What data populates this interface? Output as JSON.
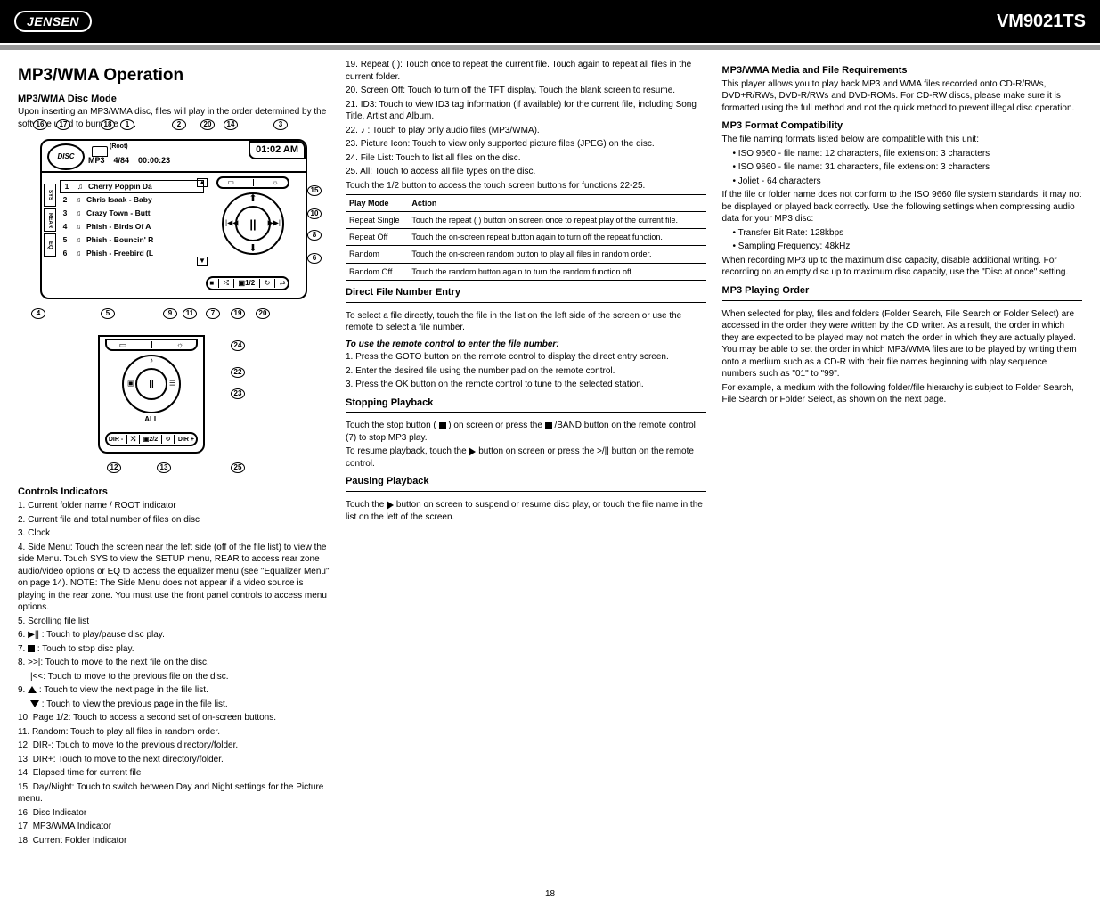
{
  "brand": "JENSEN",
  "model": "VM9021TS",
  "page_number": "18",
  "section_title": "MP3/WMA Operation",
  "section_subtitle": "MP3/WMA Disc Mode",
  "section_intro": "Upon inserting an MP3/WMA disc, files will play in the order determined by the software used to burn the CD.",
  "device_display": {
    "disc_label": "DISC",
    "root_label": "(Root)",
    "mp3_label": "MP3",
    "track_count": "4/84",
    "elapsed": "00:00:23",
    "clock": "01:02 AM",
    "tracks": [
      {
        "n": "1",
        "title": "Cherry Poppin Da"
      },
      {
        "n": "2",
        "title": "Chris Isaak - Baby"
      },
      {
        "n": "3",
        "title": "Crazy Town - Butt"
      },
      {
        "n": "4",
        "title": "Phish - Birds Of A"
      },
      {
        "n": "5",
        "title": "Phish - Bouncin' R"
      },
      {
        "n": "6",
        "title": "Phish - Freebird (L"
      }
    ],
    "sidebar_tabs": [
      "SYS",
      "REAR",
      "EQ"
    ],
    "iconbar_bot_label": "1/2",
    "wheel_center": "||"
  },
  "diagram2": {
    "wheel_center": "||",
    "wheel_top": "♪",
    "wheel_left": "▣",
    "wheel_right_icon": "list-icon",
    "all_label": "ALL",
    "dirbar_left": "DIR -",
    "dirbar_mid": "2/2",
    "dirbar_right": "DIR +"
  },
  "callouts_top": [
    "16",
    "17",
    "18",
    "1",
    "2",
    "20",
    "14",
    "3"
  ],
  "callouts_right": [
    "15",
    "10",
    "8",
    "6"
  ],
  "callouts_bottom": [
    "4",
    "5",
    "9",
    "11",
    "7",
    "19",
    "20"
  ],
  "callouts_d2_right": [
    "24",
    "22",
    "23"
  ],
  "callouts_d2_bottom": [
    "12",
    "13",
    "25"
  ],
  "controls": {
    "heading": "Controls Indicators",
    "row1_label": "1.",
    "row1_text": "Current folder name / ROOT indicator",
    "row2_label": "2.",
    "row2_text": "Current file and total number of files on disc",
    "row3_label": "3.",
    "row3_text": "Clock",
    "row4_label": "4.",
    "row4_text": "Side Menu: Touch the screen near the left side (off of the file list) to view the side Menu. Touch SYS to view the SETUP menu, REAR to access rear zone audio/video options or EQ to access the equalizer menu (see \"Equalizer Menu\" on page 14). NOTE: The Side Menu does not appear if a video source is playing in the rear zone. You must use the front panel controls to access menu options.",
    "row5_label": "5.",
    "row5_text": "Scrolling file list",
    "row6_label": "6.",
    "row6_text": ": Touch to play/pause disc play.",
    "row7_label": "7.",
    "row7_body": ": Touch to stop disc play.",
    "row8_label": "8.",
    "row8_a": ">>|: Touch to move to the next file on the disc.",
    "row8_b": "|<<: Touch to move to the previous file on the disc.",
    "row9_label": "9.",
    "row9_a": ": Touch to view the next page in the file list.",
    "row9_b": ": Touch to view the previous page in the file list.",
    "row10_label": "10.",
    "row10_text": "Page 1/2: Touch to access a second set of on-screen buttons.",
    "row11_label": "11.",
    "row11_text": "Random: Touch to play all files in random order.",
    "row12_label": "12.",
    "row12_text": "DIR-: Touch to move to the previous directory/folder.",
    "row13_label": "13.",
    "row13_text": "DIR+: Touch to move to the next directory/folder.",
    "row14_label": "14.",
    "row14_text": "Elapsed time for current file",
    "row15_label": "15.",
    "row15_text": "Day/Night: Touch to switch between Day and Night settings for the Picture menu.",
    "row16_label": "16.",
    "row16_text": "Disc Indicator",
    "row17_label": "17.",
    "row17_text": "MP3/WMA Indicator",
    "row18_label": "18.",
    "row18_text": "Current Folder Indicator"
  },
  "col2": {
    "r19_label": "19.",
    "r19_text": "Repeat (     ): Touch once to repeat the current file. Touch again to repeat all files in the current folder.",
    "r20_label": "20.",
    "r20_text": "Screen Off: Touch to turn off the TFT display. Touch the blank screen to resume.",
    "r21_label": "21.",
    "r21_text": "ID3: Touch to view ID3 tag information (if available) for the current file, including Song Title, Artist and Album.",
    "r22_label": "22.",
    "r22_text": "♪ : Touch to play only audio files (MP3/WMA).",
    "r23_label": "23.",
    "r23_text": "Picture Icon: Touch to view only supported picture files (JPEG) on the disc.",
    "r24_label": "24.",
    "r24_text": "File List: Touch to list all files on the disc.",
    "r25_label": "25.",
    "r25_text": "All: Touch to access all file types on the disc.",
    "play_table_heading": "Touch the 1/2 button to access the touch screen buttons for functions 22-25.",
    "table": {
      "h_mode": "Play Mode",
      "h_action": "Action",
      "rows": [
        {
          "mode": "Repeat Single",
          "action": "Touch the repeat (   ) button on screen once to repeat play of the current file."
        },
        {
          "mode": "Repeat Off",
          "action": "Touch the on-screen repeat button again to turn off the repeat function."
        },
        {
          "mode": "Random",
          "action": "Touch the on-screen random button to play all files in random order."
        },
        {
          "mode": "Random Off",
          "action": "Touch the random button again to turn the random function off."
        }
      ]
    },
    "h_direct_file": "Direct File Number Entry",
    "direct_file_intro": "To select a file directly, touch the file in the list on the left side of the screen or use the remote to select a file number.",
    "remote_title": "To use the remote control to enter the file number:",
    "remote_1": "1.  Press the GOTO button on the remote control to display the direct entry screen.",
    "remote_2": "2.  Enter the desired file using the number pad on the remote control.",
    "remote_3": "3.  Press the OK button on the remote control to tune to the selected station.",
    "h_stopping": "Stopping Playback",
    "stop_1": "Touch the stop button (   ) on screen or press the     /BAND button on the remote control (7) to stop MP3 play.",
    "stop_2": "To resume playback, touch the     button on screen or press the >/|| button on the remote control.",
    "h_pausing": "Pausing Playback",
    "pause_1": "Touch the     button on screen to suspend or resume disc play, or touch the file name in the list on the left of the screen."
  },
  "col3": {
    "h_media": "MP3/WMA Media and File Requirements",
    "media_p": "This player allows you to play back MP3 and WMA files recorded onto CD-R/RWs, DVD+R/RWs, DVD-R/RWs and DVD-ROMs. For CD-RW discs, please make sure it is formatted using the full method and not the quick method to prevent illegal disc operation.",
    "h_compat": "MP3 Format Compatibility",
    "compat_intro": "The file naming formats listed below are compatible with this unit:",
    "compat_li": [
      "ISO 9660 - file name: 12 characters, file extension: 3 characters",
      "ISO 9660 - file name: 31 characters, file extension: 3 characters",
      "Joliet - 64 characters"
    ],
    "compat_p2": "If the file or folder name does not conform to the ISO 9660 file system standards, it may not be displayed or played back correctly. Use the following settings when compressing audio data for your MP3 disc:",
    "compat_li2": [
      "Transfer Bit Rate: 128kbps",
      "Sampling Frequency: 48kHz"
    ],
    "compat_p3": "When recording MP3 up to the maximum disc capacity, disable additional writing. For recording on an empty disc up to maximum disc capacity, use the \"Disc at once\" setting.",
    "h_order": "MP3 Playing Order",
    "order_p1": "When selected for play, files and folders (Folder Search, File Search or Folder Select) are accessed in the order they were written by the CD writer. As a result, the order in which they are expected to be played may not match the order in which they are actually played. You may be able to set the order in which MP3/WMA files are to be played by writing them onto a medium such as a CD-R with their file names beginning with play sequence numbers such as \"01\" to \"99\".",
    "order_p2": "For example, a medium with the following folder/file hierarchy is subject to Folder Search, File Search or Folder Select, as shown on the next page."
  }
}
